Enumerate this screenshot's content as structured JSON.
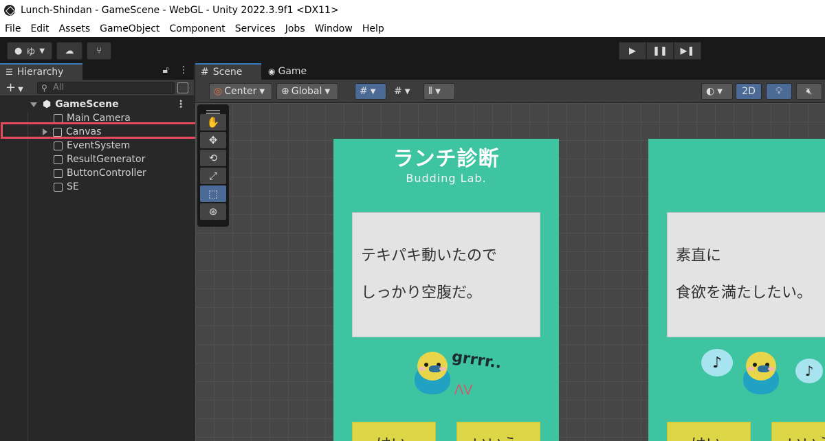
{
  "window": {
    "title": "Lunch-Shindan - GameScene - WebGL - Unity 2022.3.9f1 <DX11>"
  },
  "menu": {
    "items": [
      "File",
      "Edit",
      "Assets",
      "GameObject",
      "Component",
      "Services",
      "Jobs",
      "Window",
      "Help"
    ]
  },
  "toolbar": {
    "account_label": "ゆ"
  },
  "hierarchy": {
    "tab_label": "Hierarchy",
    "search_placeholder": "All",
    "scene_name": "GameScene",
    "items": [
      "Main Camera",
      "Canvas",
      "EventSystem",
      "ResultGenerator",
      "ButtonController",
      "SE"
    ]
  },
  "scene": {
    "tabs": [
      "Scene",
      "Game"
    ],
    "pivot_label": "Center",
    "space_label": "Global",
    "mode_2d_label": "2D"
  },
  "cards": [
    {
      "title": "ランチ診断",
      "subtitle": "Budding Lab.",
      "question_line1": "テキパキ動いたので",
      "question_line2": "しっかり空腹だ。",
      "bubble_text": "grrrr..",
      "yes_label": "はい",
      "no_label": "いいえ"
    },
    {
      "question_line1": "素直に",
      "question_line2": "食欲を満たしたい。",
      "note_symbol": "♪",
      "yes_label": "はい",
      "no_label": "いいえ"
    }
  ],
  "colors": {
    "card_bg": "#3ec4a0",
    "button_yellow": "#ddd748",
    "highlight_red": "#e84a5f",
    "selected_blue": "#4b6b96"
  }
}
